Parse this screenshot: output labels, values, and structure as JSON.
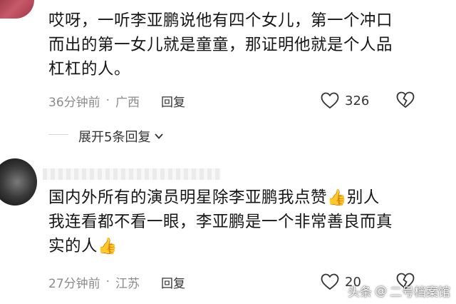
{
  "comments": [
    {
      "text_lines": [
        "哎呀，一听李亚鹏说他有四个女儿，第一个冲口",
        "而出的第一女儿就是童童，那证明他就是个人品",
        "杠杠的人。"
      ],
      "time": "36分钟前",
      "location": "广西",
      "reply_label": "回复",
      "likes": "326"
    },
    {
      "text_line1": "国内外所有的演员明星除李亚鹏我点赞",
      "text_line1b": "别人",
      "text_line2": "我连看都不看一眼，李亚鹏是一个非常善良而真",
      "text_line3": "实的人",
      "time": "27分钟前",
      "location": "江苏",
      "reply_label": "回复",
      "likes": "20"
    }
  ],
  "expand_replies": "展开5条回复",
  "separator": "·",
  "watermark": {
    "prefix": "头条",
    "at": "@",
    "account": "二号档案馆"
  },
  "icons": {
    "like": "heart-outline-icon",
    "dislike": "broken-heart-icon",
    "expand": "chevron-down-icon",
    "thumbs": "thumbs-up-emoji-icon"
  }
}
